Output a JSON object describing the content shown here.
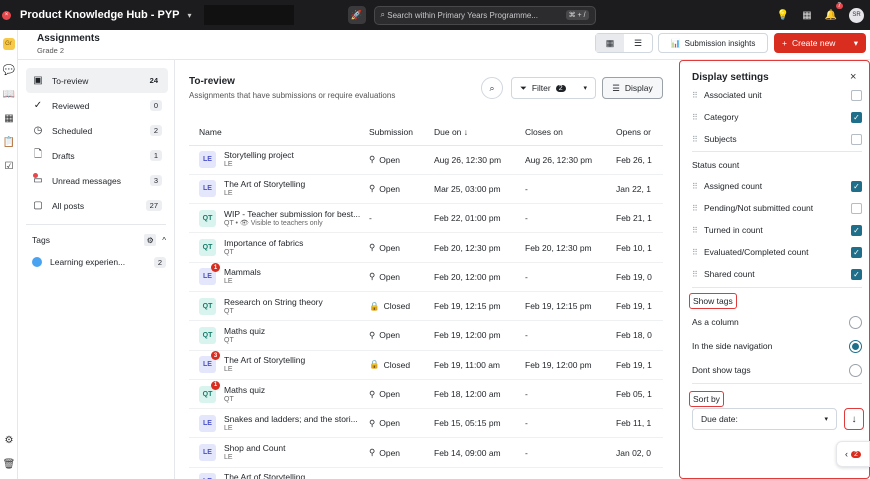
{
  "topbar": {
    "app_title": "Product Knowledge Hub - PYP",
    "search_placeholder": "Search within Primary Years Programme...",
    "search_shortcut": "⌘ + /",
    "notif_count": "7",
    "avatar": "SR"
  },
  "header": {
    "title": "Assignments",
    "subtitle": "Grade 2",
    "insights_label": "Submission insights",
    "create_label": "Create new"
  },
  "nav": {
    "items": [
      {
        "label": "To-review",
        "count": "24",
        "icon": "inbox-icon"
      },
      {
        "label": "Reviewed",
        "count": "0",
        "icon": "check-circle-icon"
      },
      {
        "label": "Scheduled",
        "count": "2",
        "icon": "clock-icon"
      },
      {
        "label": "Drafts",
        "count": "1",
        "icon": "document-icon"
      },
      {
        "label": "Unread messages",
        "count": "3",
        "icon": "message-icon"
      },
      {
        "label": "All posts",
        "count": "27",
        "icon": "posts-icon"
      }
    ],
    "tags_label": "Tags",
    "tag": {
      "label": "Learning experien...",
      "count": "2"
    }
  },
  "main": {
    "title": "To-review",
    "subtitle": "Assignments that have submissions or require evaluations",
    "filter_label": "Filter",
    "filter_count": "2",
    "display_label": "Display",
    "columns": [
      "Name",
      "Submission",
      "Due on",
      "Closes on",
      "Opens or"
    ],
    "rows": [
      {
        "type": "LE",
        "badge": "",
        "name": "Storytelling project",
        "sub": "LE",
        "submission": "Open",
        "due": "Aug 26, 12:30 pm",
        "closes": "Aug 26, 12:30 pm",
        "opens": "Feb 26, 1"
      },
      {
        "type": "LE",
        "badge": "",
        "name": "The Art of Storytelling",
        "sub": "LE",
        "submission": "Open",
        "due": "Mar 25, 03:00 pm",
        "closes": "-",
        "opens": "Jan 22, 1"
      },
      {
        "type": "QT",
        "badge": "",
        "name": "WIP - Teacher submission for best...",
        "sub": "QT • 👁 Visible to teachers only",
        "submission": "-",
        "due": "Feb 22, 01:00 pm",
        "closes": "-",
        "opens": "Feb 21, 1"
      },
      {
        "type": "QT",
        "badge": "",
        "name": "Importance of fabrics",
        "sub": "QT",
        "submission": "Open",
        "due": "Feb 20, 12:30 pm",
        "closes": "Feb 20, 12:30 pm",
        "opens": "Feb 10, 1"
      },
      {
        "type": "LE",
        "badge": "1",
        "name": "Mammals",
        "sub": "LE",
        "submission": "Open",
        "due": "Feb 20, 12:00 pm",
        "closes": "-",
        "opens": "Feb 19, 0"
      },
      {
        "type": "QT",
        "badge": "",
        "name": "Research on String theory",
        "sub": "QT",
        "submission": "Closed",
        "due": "Feb 19, 12:15 pm",
        "closes": "Feb 19, 12:15 pm",
        "opens": "Feb 19, 1"
      },
      {
        "type": "QT",
        "badge": "",
        "name": "Maths quiz",
        "sub": "QT",
        "submission": "Open",
        "due": "Feb 19, 12:00 pm",
        "closes": "-",
        "opens": "Feb 18, 0"
      },
      {
        "type": "LE",
        "badge": "3",
        "name": "The Art of Storytelling",
        "sub": "LE",
        "submission": "Closed",
        "due": "Feb 19, 11:00 am",
        "closes": "Feb 19, 12:00 pm",
        "opens": "Feb 19, 1"
      },
      {
        "type": "QT",
        "badge": "1",
        "name": "Maths quiz",
        "sub": "QT",
        "submission": "Open",
        "due": "Feb 18, 12:00 am",
        "closes": "-",
        "opens": "Feb 05, 1"
      },
      {
        "type": "LE",
        "badge": "",
        "name": "Snakes and ladders; and the stori...",
        "sub": "LE",
        "submission": "Open",
        "due": "Feb 15, 05:15 pm",
        "closes": "-",
        "opens": "Feb 11, 1"
      },
      {
        "type": "LE",
        "badge": "",
        "name": "Shop and Count",
        "sub": "LE",
        "submission": "Open",
        "due": "Feb 14, 09:00 am",
        "closes": "-",
        "opens": "Jan 02, 0"
      },
      {
        "type": "LE",
        "badge": "",
        "name": "The Art of Storytelling",
        "sub": "LE",
        "submission": "",
        "due": "",
        "closes": "",
        "opens": ""
      }
    ]
  },
  "panel": {
    "title": "Display settings",
    "top_items": [
      {
        "label": "Associated unit",
        "checked": false
      },
      {
        "label": "Category",
        "checked": true
      },
      {
        "label": "Subjects",
        "checked": false
      }
    ],
    "status_label": "Status count",
    "status_items": [
      {
        "label": "Assigned count",
        "checked": true
      },
      {
        "label": "Pending/Not submitted count",
        "checked": false
      },
      {
        "label": "Turned in count",
        "checked": true
      },
      {
        "label": "Evaluated/Completed count",
        "checked": true
      },
      {
        "label": "Shared count",
        "checked": true
      }
    ],
    "show_tags_label": "Show tags",
    "tag_options": [
      {
        "label": "As a column",
        "selected": false
      },
      {
        "label": "In the side navigation",
        "selected": true
      },
      {
        "label": "Dont show tags",
        "selected": false
      }
    ],
    "sort_label": "Sort by",
    "sort_value": "Due date:"
  },
  "float_count": "2"
}
